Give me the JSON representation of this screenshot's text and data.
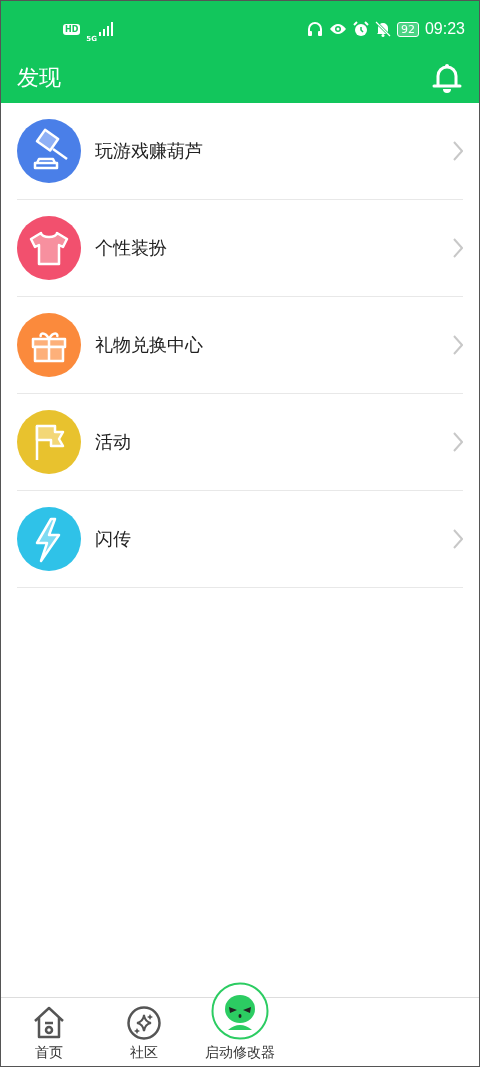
{
  "status_bar": {
    "hd": "HD",
    "network": "5G",
    "battery": "92",
    "time": "09:23"
  },
  "header": {
    "title": "发现"
  },
  "items": [
    {
      "label": "玩游戏赚葫芦",
      "kind": "gavel",
      "color": "#4a7fe8"
    },
    {
      "label": "个性装扮",
      "kind": "shirt",
      "color": "#f2506e"
    },
    {
      "label": "礼物兑换中心",
      "kind": "gift",
      "color": "#fb8a3c"
    },
    {
      "label": "活动",
      "kind": "flag",
      "color": "#e8c22e"
    },
    {
      "label": "闪传",
      "kind": "bolt",
      "color": "#2fc2e8"
    }
  ],
  "nav": [
    {
      "label": "首页",
      "kind": "home"
    },
    {
      "label": "社区",
      "kind": "community"
    },
    {
      "label": "启动修改器",
      "kind": "launch"
    }
  ]
}
